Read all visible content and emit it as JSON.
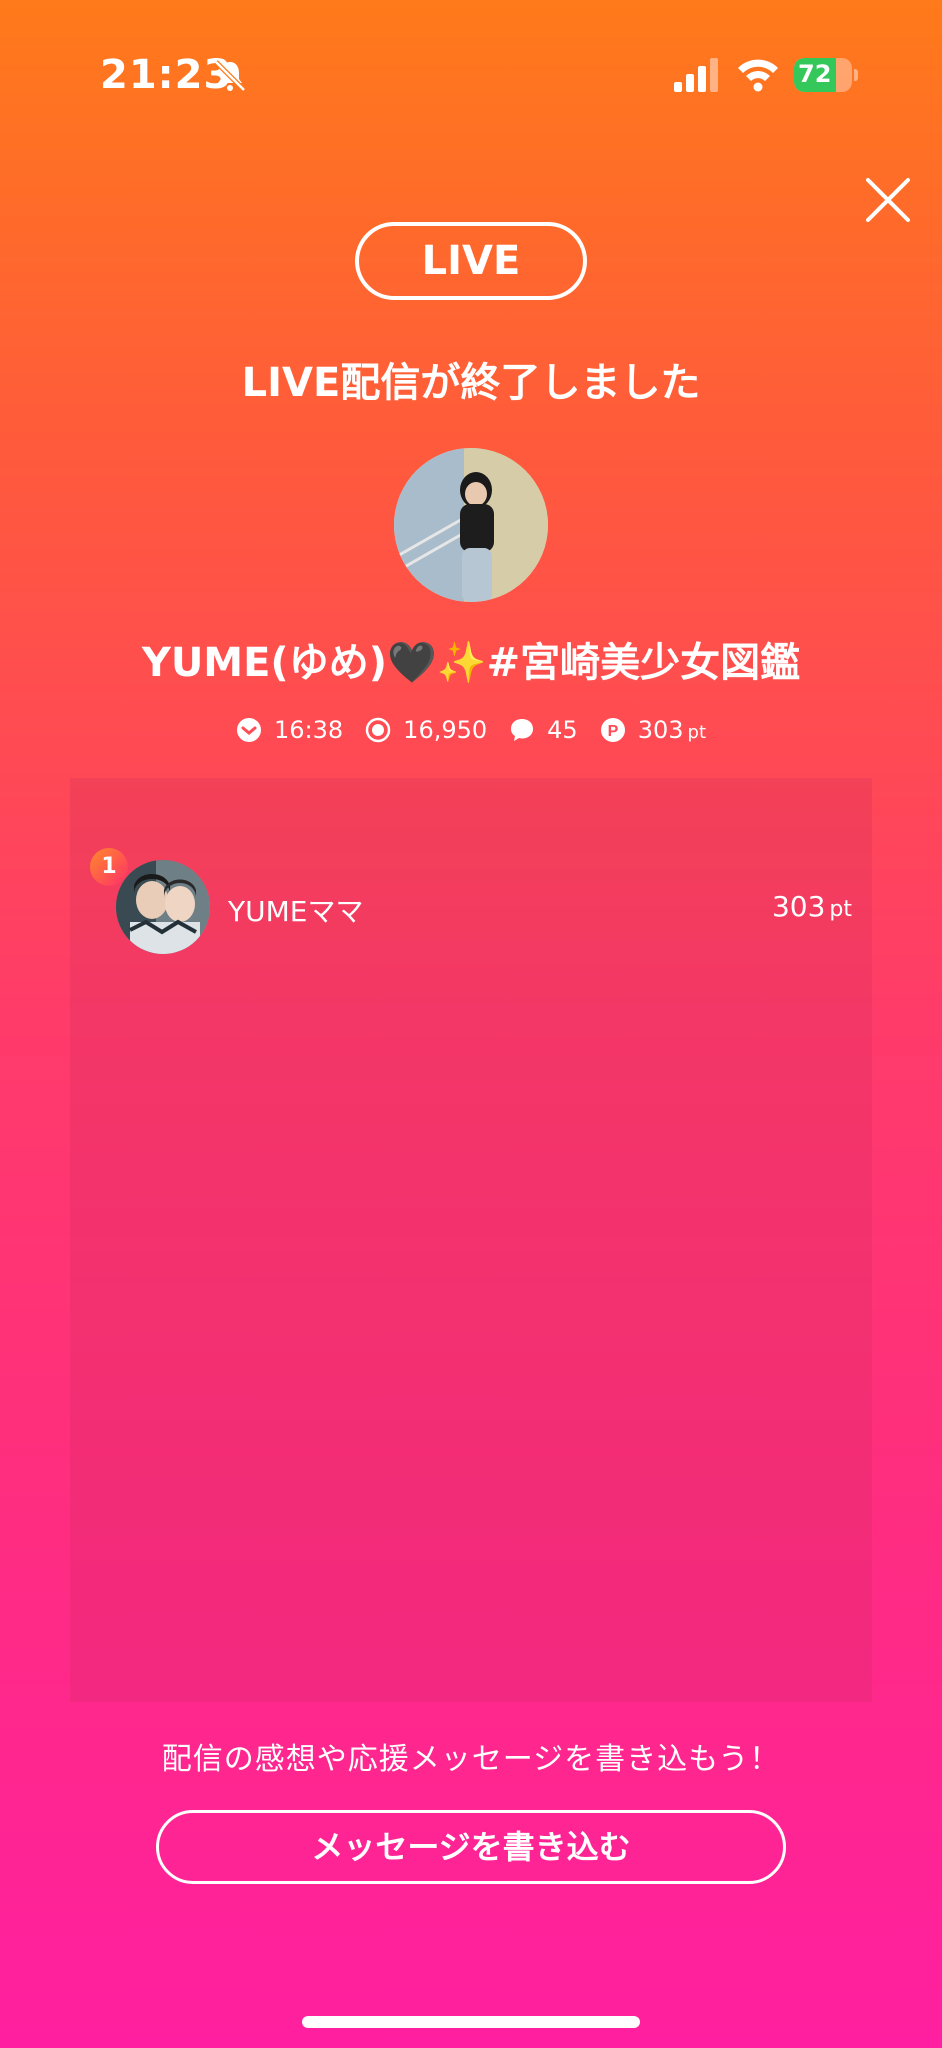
{
  "status_bar": {
    "time": "21:23",
    "battery_percent": "72",
    "battery_level": 0.72,
    "battery_color": "#34c759"
  },
  "header": {
    "live_badge": "LIVE",
    "title": "LIVE配信が終了しました",
    "close_icon": "close-icon"
  },
  "streamer": {
    "name": "YUME(ゆめ)🖤✨#宮崎美少女図鑑"
  },
  "stats": {
    "duration": "16:38",
    "viewers": "16,950",
    "comments": "45",
    "points": "303",
    "points_unit": "pt"
  },
  "ranking": {
    "entries": [
      {
        "rank": "1",
        "name": "YUMEママ",
        "points": "303",
        "unit": "pt"
      }
    ]
  },
  "footer": {
    "prompt": "配信の感想や応援メッセージを書き込もう！",
    "button_label": "メッセージを書き込む"
  },
  "colors": {
    "gradient_top": "#ff7a1a",
    "gradient_bottom": "#ff1fa0"
  }
}
